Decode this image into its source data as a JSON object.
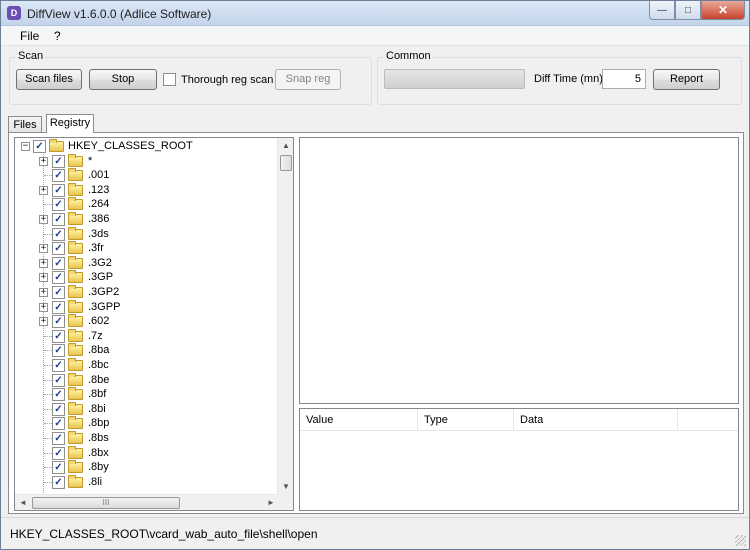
{
  "window": {
    "title": "DiffView v1.6.0.0 (Adlice Software)",
    "app_icon_glyph": "D",
    "caption": {
      "minimize": "—",
      "maximize": "□",
      "close": "✕"
    }
  },
  "menu": [
    "File",
    "?"
  ],
  "scan": {
    "label": "Scan",
    "scan_files": "Scan files",
    "stop": "Stop",
    "thorough_label": "Thorough reg scan",
    "thorough_checked": false,
    "snap_reg": "Snap reg"
  },
  "common": {
    "label": "Common",
    "progress": 0,
    "diff_time_label": "Diff Time (mn)",
    "diff_time_value": "5",
    "report": "Report"
  },
  "tabs": [
    {
      "label": "Files",
      "active": false
    },
    {
      "label": "Registry",
      "active": true
    }
  ],
  "tree": {
    "check_glyph": "✓",
    "expand_glyph": "+",
    "collapse_glyph": "−",
    "root": "HKEY_CLASSES_ROOT",
    "items": [
      {
        "label": "*",
        "expandable": true
      },
      {
        "label": ".001",
        "expandable": false
      },
      {
        "label": ".123",
        "expandable": true
      },
      {
        "label": ".264",
        "expandable": false
      },
      {
        "label": ".386",
        "expandable": true
      },
      {
        "label": ".3ds",
        "expandable": false
      },
      {
        "label": ".3fr",
        "expandable": true
      },
      {
        "label": ".3G2",
        "expandable": true
      },
      {
        "label": ".3GP",
        "expandable": true
      },
      {
        "label": ".3GP2",
        "expandable": true
      },
      {
        "label": ".3GPP",
        "expandable": true
      },
      {
        "label": ".602",
        "expandable": true
      },
      {
        "label": ".7z",
        "expandable": false
      },
      {
        "label": ".8ba",
        "expandable": false
      },
      {
        "label": ".8bc",
        "expandable": false
      },
      {
        "label": ".8be",
        "expandable": false
      },
      {
        "label": ".8bf",
        "expandable": false
      },
      {
        "label": ".8bi",
        "expandable": false
      },
      {
        "label": ".8bp",
        "expandable": false
      },
      {
        "label": ".8bs",
        "expandable": false
      },
      {
        "label": ".8bx",
        "expandable": false
      },
      {
        "label": ".8by",
        "expandable": false
      },
      {
        "label": ".8li",
        "expandable": false
      }
    ],
    "scroll": {
      "up": "▲",
      "down": "▼",
      "left": "◄",
      "right": "►",
      "thumb_grip": "III"
    }
  },
  "values_list": {
    "columns": [
      "Value",
      "Type",
      "Data"
    ]
  },
  "status": {
    "path": "HKEY_CLASSES_ROOT\\vcard_wab_auto_file\\shell\\open"
  }
}
